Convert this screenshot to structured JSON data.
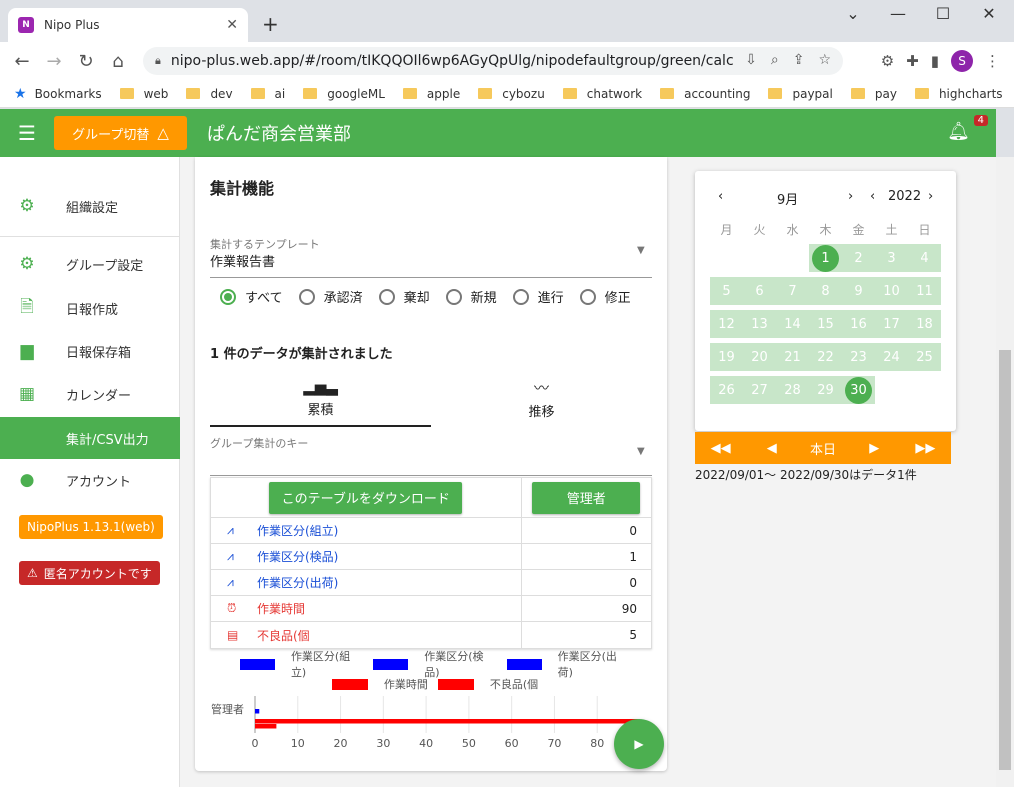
{
  "browser": {
    "tab_title": "Nipo Plus",
    "tab_icon": "N",
    "url": "nipo-plus.web.app/#/room/tIKQQOIl6wp6AGyQpUlg/nipodefaultgroup/green/calc",
    "profile_initial": "S",
    "bookmarks": [
      "Bookmarks",
      "web",
      "dev",
      "ai",
      "googleML",
      "apple",
      "cybozu",
      "chatwork",
      "accounting",
      "paypal",
      "pay",
      "highcharts"
    ]
  },
  "appbar": {
    "group_switch": "グループ切替",
    "title": "ぱんだ商会営業部",
    "notification_count": "4"
  },
  "sidebar": {
    "items": [
      {
        "label": "組織設定",
        "icon": "gear-icon"
      },
      {
        "label": "グループ設定",
        "icon": "settings-box-icon"
      },
      {
        "label": "日報作成",
        "icon": "file-add-icon"
      },
      {
        "label": "日報保存箱",
        "icon": "folder-icon"
      },
      {
        "label": "カレンダー",
        "icon": "calendar-icon"
      },
      {
        "label": "集計/CSV出力",
        "icon": "none"
      },
      {
        "label": "アカウント",
        "icon": "account-icon"
      }
    ],
    "version": "NipoPlus 1.13.1(web)",
    "anonymous": "匿名アカウントです"
  },
  "main": {
    "title": "集計機能",
    "template_label": "集計するテンプレート",
    "template_value": "作業報告書",
    "radios": [
      {
        "label": "すべて",
        "checked": true
      },
      {
        "label": "承認済",
        "checked": false
      },
      {
        "label": "棄却",
        "checked": false
      },
      {
        "label": "新規",
        "checked": false
      },
      {
        "label": "進行",
        "checked": false
      },
      {
        "label": "修正",
        "checked": false
      }
    ],
    "summary": "1 件のデータが集計されました",
    "tabs": [
      {
        "label": "累積",
        "icon": "bar-chart-icon"
      },
      {
        "label": "推移",
        "icon": "trend-icon"
      }
    ],
    "group_key_label": "グループ集計のキー",
    "download_button": "このテーブルをダウンロード",
    "column_button": "管理者",
    "rows": [
      {
        "label": "作業区分(組立)",
        "value": "0",
        "color": "#1a4fd6",
        "icon": "chart-line-icon"
      },
      {
        "label": "作業区分(検品)",
        "value": "1",
        "color": "#1a4fd6",
        "icon": "chart-line-icon"
      },
      {
        "label": "作業区分(出荷)",
        "value": "0",
        "color": "#1a4fd6",
        "icon": "chart-line-icon"
      },
      {
        "label": "作業時間",
        "value": "90",
        "color": "#e53935",
        "icon": "alarm-icon"
      },
      {
        "label": "不良品(個",
        "value": "5",
        "color": "#e53935",
        "icon": "calculator-icon"
      }
    ]
  },
  "chart_data": {
    "type": "bar",
    "orientation": "horizontal",
    "categories": [
      "管理者"
    ],
    "series": [
      {
        "name": "作業区分(組立)",
        "values": [
          0
        ],
        "color": "#0000ff"
      },
      {
        "name": "作業区分(検品)",
        "values": [
          1
        ],
        "color": "#0000ff"
      },
      {
        "name": "作業区分(出荷)",
        "values": [
          0
        ],
        "color": "#0000ff"
      },
      {
        "name": "作業時間",
        "values": [
          90
        ],
        "color": "#ff0000"
      },
      {
        "name": "不良品(個",
        "values": [
          5
        ],
        "color": "#ff0000"
      }
    ],
    "xticks": [
      0,
      10,
      20,
      30,
      40,
      50,
      60,
      70,
      80
    ],
    "xlim": [
      0,
      90
    ],
    "legend": "top"
  },
  "calendar": {
    "month": "9月",
    "year": "2022",
    "weekdays": [
      "月",
      "火",
      "水",
      "木",
      "金",
      "土",
      "日"
    ],
    "first_weekday_index": 3,
    "days_in_month": 30,
    "highlighted": [
      1,
      30
    ],
    "controls": [
      "◀◀",
      "◀",
      "本日",
      "▶",
      "▶▶"
    ],
    "range_text": "2022/09/01～ 2022/09/30はデータ1件"
  }
}
